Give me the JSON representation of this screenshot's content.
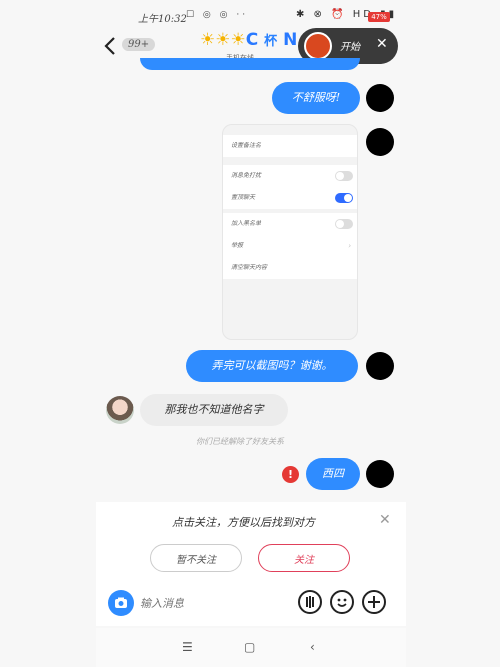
{
  "status_bar": {
    "time": "上午10:32",
    "left_icons": "☐ ◎ ◎ ··",
    "right_icons": "✱ ⊗ ⏰ HD ▮▮",
    "battery": "47%"
  },
  "header": {
    "unread_count": "99+",
    "title_stars": "☀☀☀",
    "title_c": "C",
    "title_zh": "杯",
    "title_n": "N",
    "subtitle": "手机在线"
  },
  "recorder": {
    "start_label": "开始"
  },
  "messages": [
    {
      "side": "right",
      "text": "不舒服呀!"
    },
    {
      "side": "right",
      "text": "弄完可以截图吗？谢谢。"
    },
    {
      "side": "left",
      "text": "那我也不知道他名字"
    },
    {
      "side": "right",
      "text": "西四"
    }
  ],
  "screenshot": {
    "rows": [
      "设置备注名",
      "消息免打扰",
      "置顶聊天",
      "加入黑名单",
      "举报",
      "清空聊天内容"
    ]
  },
  "system_note": "你们已经解除了好友关系",
  "follow_panel": {
    "text": "点击关注，方便以后找到对方",
    "later_label": "暂不关注",
    "follow_label": "关注"
  },
  "input": {
    "placeholder": "输入消息"
  },
  "colors": {
    "bubble_blue": "#2f8cff",
    "follow_red": "#e0405a",
    "error_red": "#e53935"
  }
}
